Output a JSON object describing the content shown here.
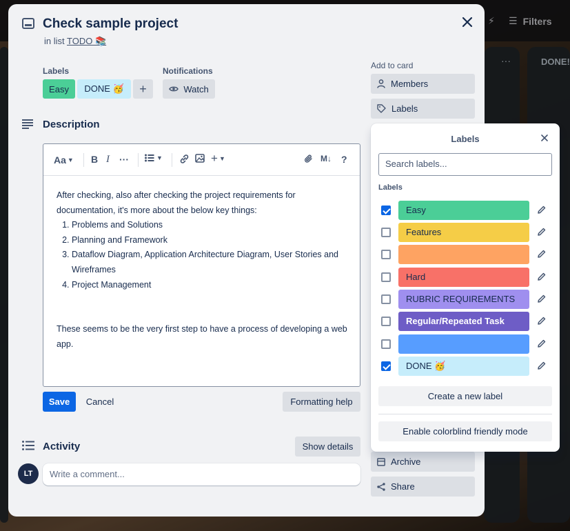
{
  "background": {
    "filters_label": "Filters",
    "done_column": "DONE!"
  },
  "card": {
    "title": "Check sample project",
    "in_list_prefix": "in list",
    "list_name": "TODO 📚"
  },
  "labels_section": {
    "heading": "Labels",
    "chips": [
      {
        "name": "Easy",
        "color": "#4bce97"
      },
      {
        "name": "DONE 🥳",
        "color": "#c6edfb"
      }
    ],
    "add_symbol": "+"
  },
  "notifications": {
    "heading": "Notifications",
    "watch_label": "Watch"
  },
  "description": {
    "heading": "Description",
    "toolbar": {
      "text_style": "Aa",
      "bold": "B",
      "italic": "I",
      "more": "···",
      "markdown": "M↓",
      "help": "?"
    },
    "intro": "After checking, also after checking the project requirements for documentation, it's more about the below key things:",
    "list": [
      "Problems and Solutions",
      "Planning and Framework",
      "Dataflow Diagram, Application Architecture Diagram, User Stories and Wireframes",
      "Project Management"
    ],
    "outro": "These seems to be the very first step to have a process of developing a web app.",
    "save_label": "Save",
    "cancel_label": "Cancel",
    "formatting_help_label": "Formatting help"
  },
  "activity": {
    "heading": "Activity",
    "show_details_label": "Show details",
    "avatar_initials": "LT",
    "comment_placeholder": "Write a comment..."
  },
  "sidebar": {
    "heading": "Add to card",
    "members_label": "Members",
    "labels_label": "Labels",
    "archive_label": "Archive",
    "share_label": "Share"
  },
  "labels_popover": {
    "title": "Labels",
    "search_placeholder": "Search labels...",
    "subheading": "Labels",
    "items": [
      {
        "name": "Easy",
        "color": "#4bce97",
        "checked": true
      },
      {
        "name": "Features",
        "color": "#f5cd47",
        "checked": false
      },
      {
        "name": "",
        "color": "#fea362",
        "checked": false
      },
      {
        "name": "Hard",
        "color": "#f87168",
        "checked": false
      },
      {
        "name": "RUBRIC REQUIREMENTS",
        "color": "#9f8fef",
        "checked": false
      },
      {
        "name": "Regular/Repeated Task",
        "color": "#6e5dc6",
        "checked": false
      },
      {
        "name": "",
        "color": "#579dff",
        "checked": false
      },
      {
        "name": "DONE 🥳",
        "color": "#c6edfb",
        "checked": true
      }
    ],
    "create_label": "Create a new label",
    "colorblind_label": "Enable colorblind friendly mode"
  }
}
